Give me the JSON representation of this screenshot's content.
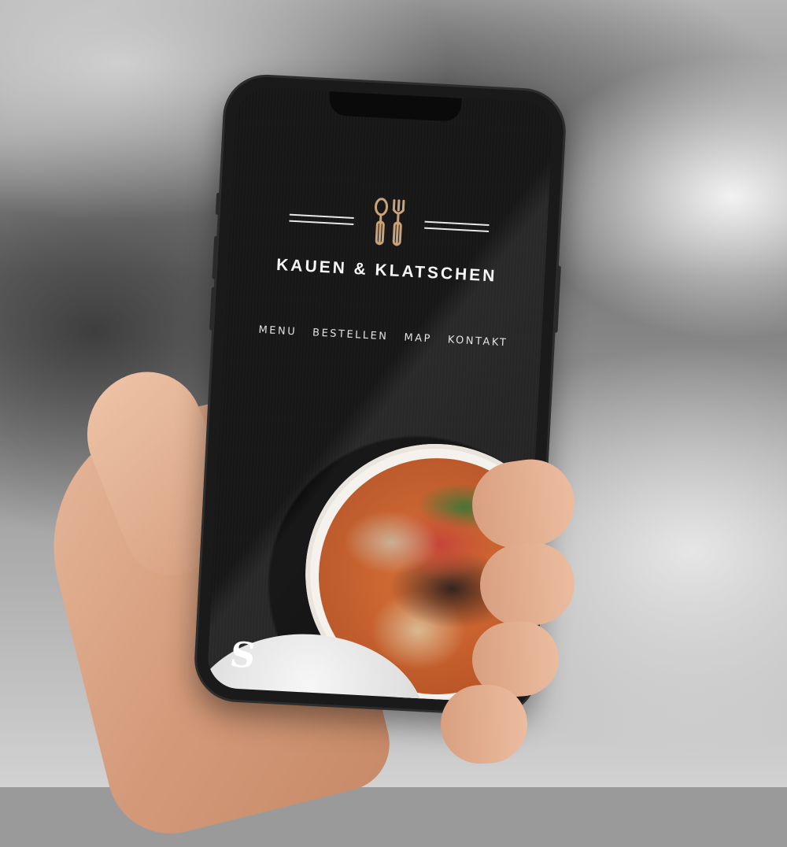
{
  "brand": {
    "name": "KAUEN & KLATSCHEN",
    "logo_icon": "cutlery-icon",
    "accent_color": "#c9a27a"
  },
  "nav": {
    "items": [
      {
        "label": "MENU"
      },
      {
        "label": "BESTELLEN"
      },
      {
        "label": "MAP"
      },
      {
        "label": "KONTAKT"
      }
    ]
  },
  "watermark": {
    "letter": "S"
  }
}
